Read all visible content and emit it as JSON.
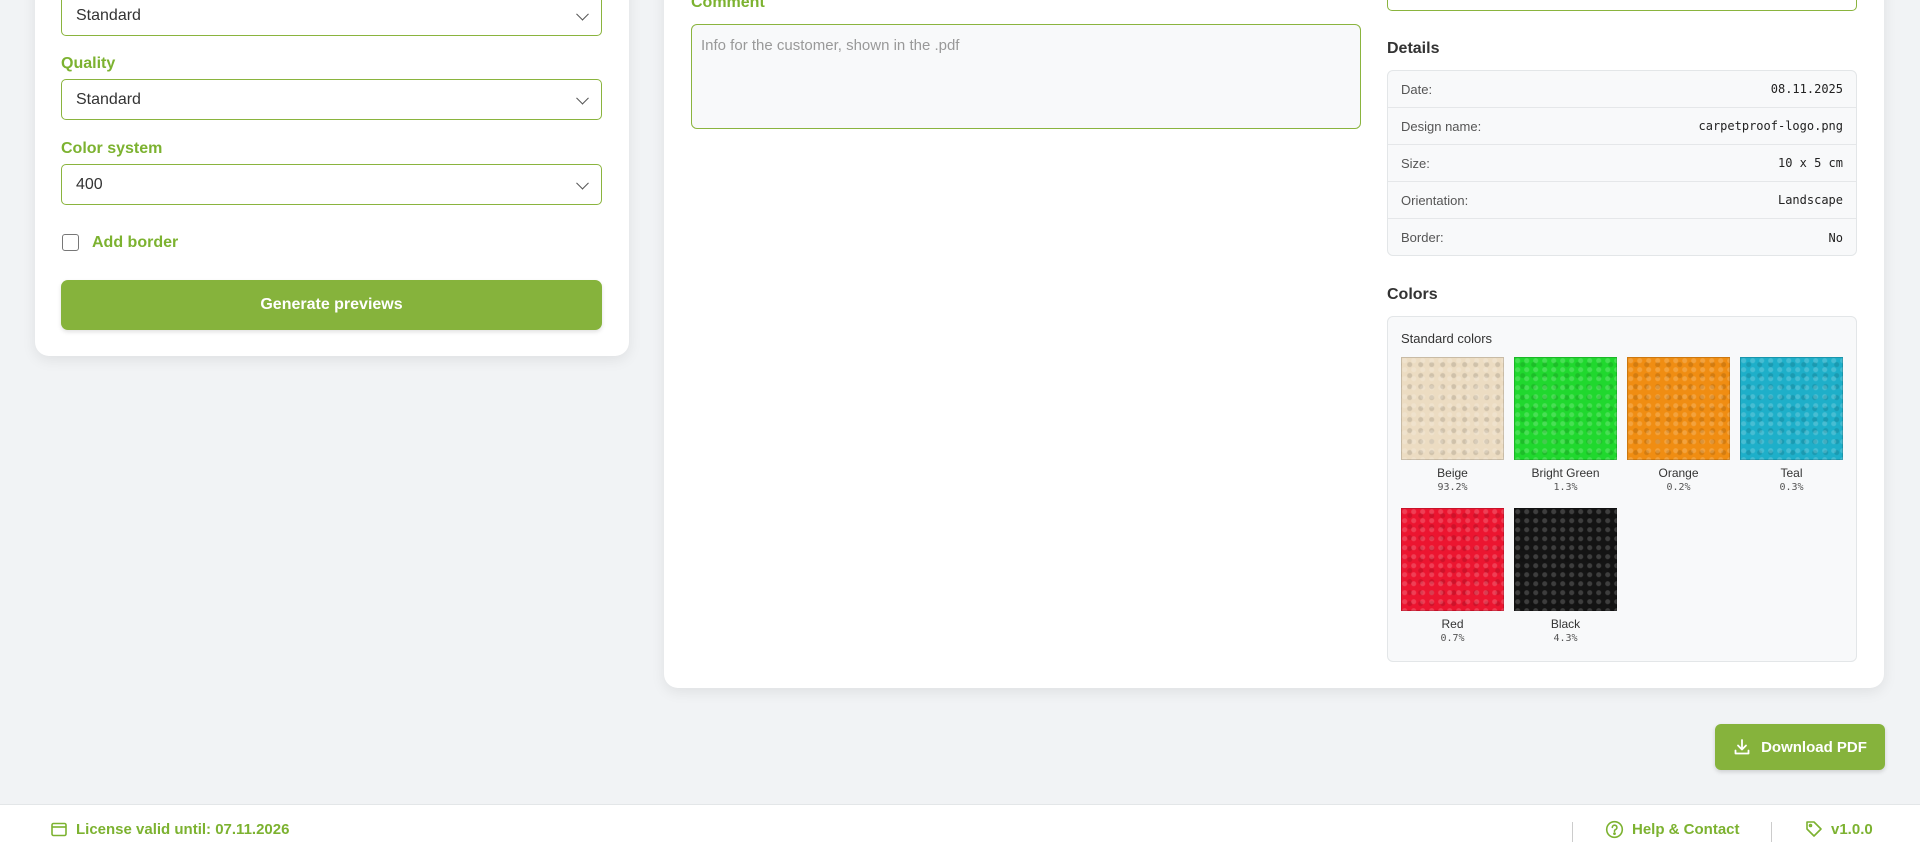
{
  "left_panel": {
    "top_select_value": "Standard",
    "quality": {
      "label": "Quality",
      "value": "Standard"
    },
    "color_system": {
      "label": "Color system",
      "value": "400"
    },
    "add_border_label": "Add border",
    "generate_button": "Generate previews"
  },
  "comment": {
    "label": "Comment",
    "placeholder": "Info for the customer, shown in the .pdf"
  },
  "details": {
    "title": "Details",
    "rows": [
      {
        "key": "Date:",
        "value": "08.11.2025"
      },
      {
        "key": "Design name:",
        "value": "carpetproof-logo.png"
      },
      {
        "key": "Size:",
        "value": "10 x 5 cm"
      },
      {
        "key": "Orientation:",
        "value": "Landscape"
      },
      {
        "key": "Border:",
        "value": "No"
      }
    ]
  },
  "colors": {
    "title": "Colors",
    "subtitle": "Standard colors",
    "swatches": [
      {
        "name": "Beige",
        "percent": "93.2%",
        "color": "#ecdcc2"
      },
      {
        "name": "Bright Green",
        "percent": "1.3%",
        "color": "#20d82e"
      },
      {
        "name": "Orange",
        "percent": "0.2%",
        "color": "#f08d12"
      },
      {
        "name": "Teal",
        "percent": "0.3%",
        "color": "#1eafc9"
      },
      {
        "name": "Red",
        "percent": "0.7%",
        "color": "#ec1530"
      },
      {
        "name": "Black",
        "percent": "4.3%",
        "color": "#141414"
      }
    ]
  },
  "download_button": "Download PDF",
  "footer": {
    "license": "License valid until: 07.11.2026",
    "help": "Help & Contact",
    "version": "v1.0.0"
  },
  "theme": {
    "accent": "#86b33c",
    "label_green": "#7cb230"
  }
}
